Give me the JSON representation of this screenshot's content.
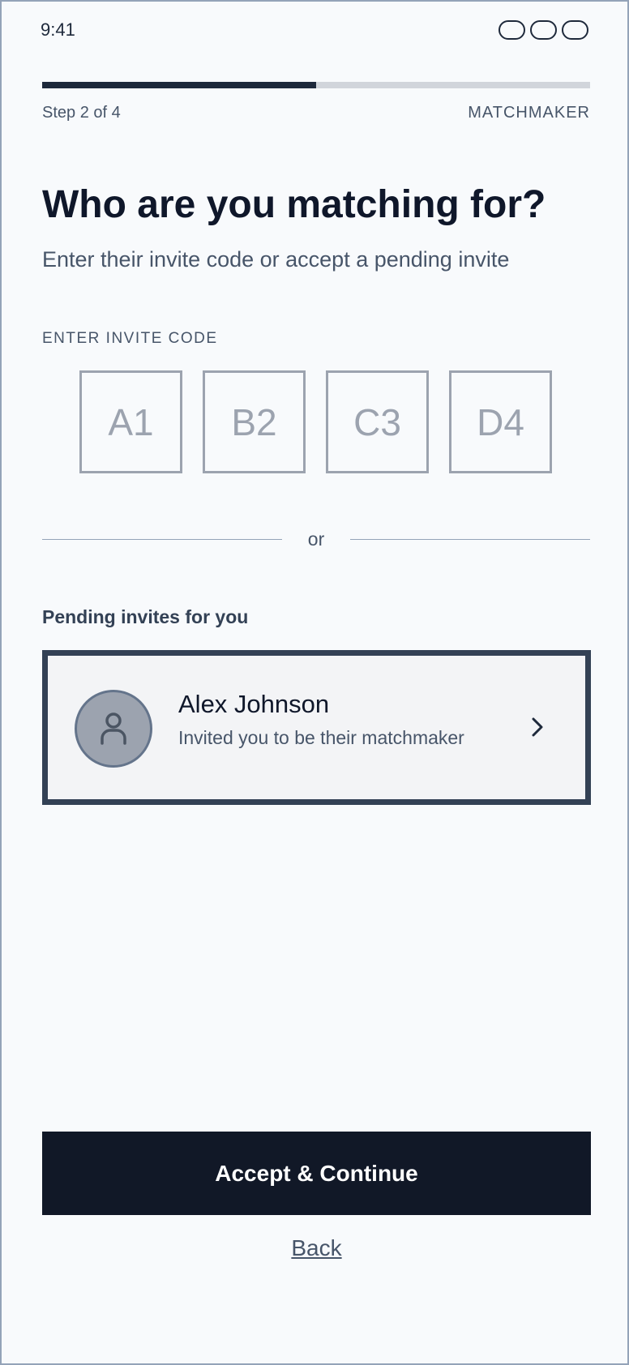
{
  "status_bar": {
    "time": "9:41",
    "icons": [
      "signal-icon",
      "wifi-icon",
      "battery-icon"
    ]
  },
  "progress": {
    "step_text": "Step 2 of 4",
    "brand": "MATCHMAKER",
    "fraction": 0.5
  },
  "header": {
    "title": "Who are you matching for?",
    "subtitle": "Enter their invite code or accept a pending invite"
  },
  "invite_code": {
    "label": "ENTER INVITE CODE",
    "boxes": [
      "A1",
      "B2",
      "C3",
      "D4"
    ]
  },
  "divider_text": "or",
  "pending": {
    "label": "Pending invites for you",
    "invite": {
      "name": "Alex Johnson",
      "description": "Invited you to be their matchmaker",
      "avatar_icon": "person-icon",
      "chevron_icon": "chevron-right-icon"
    }
  },
  "actions": {
    "primary_label": "Accept & Continue",
    "back_label": "Back"
  },
  "colors": {
    "primary": "#111827",
    "card_border": "#334155",
    "muted": "#9ca3af",
    "background": "#f8fafc"
  }
}
